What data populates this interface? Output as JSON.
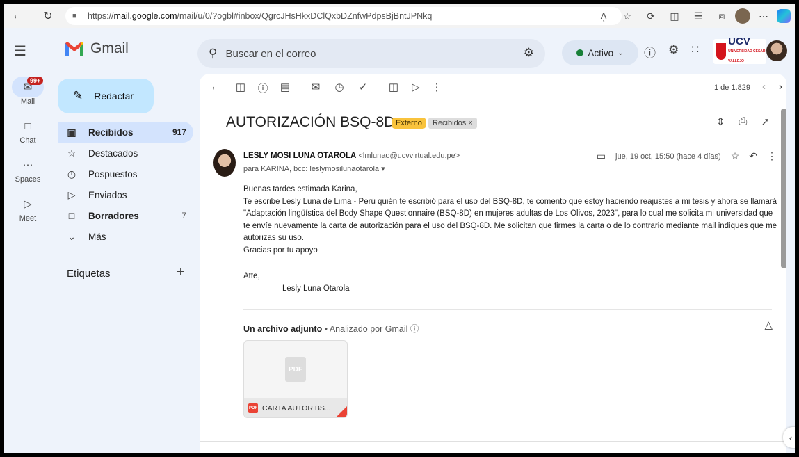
{
  "browser": {
    "url_prefix": "https://",
    "url_host": "mail.google.com",
    "url_path": "/mail/u/0/?ogbl#inbox/QgrcJHsHkxDClQxbDZnfwPdpsBjBntJPNkq",
    "reader_label": "Aͅ"
  },
  "header": {
    "brand": "Gmail",
    "search_placeholder": "Buscar en el correo",
    "status": "Activo",
    "org_logo": "UCV",
    "org_logo_sub": "UNIVERSIDAD CÉSAR VALLEJO"
  },
  "rail": {
    "items": [
      {
        "label": "Mail",
        "badge": "99+"
      },
      {
        "label": "Chat"
      },
      {
        "label": "Spaces"
      },
      {
        "label": "Meet"
      }
    ]
  },
  "compose_label": "Redactar",
  "nav": {
    "items": [
      {
        "label": "Recibidos",
        "count": "917"
      },
      {
        "label": "Destacados"
      },
      {
        "label": "Pospuestos"
      },
      {
        "label": "Enviados"
      },
      {
        "label": "Borradores",
        "count": "7"
      },
      {
        "label": "Más"
      }
    ],
    "labels_heading": "Etiquetas"
  },
  "toolbar": {
    "pager": "1 de 1.829"
  },
  "email": {
    "subject": "AUTORIZACIÓN BSQ-8D",
    "chip_external": "Externo",
    "chip_inbox": "Recibidos ×",
    "sender_name": "LESLY MOSI LUNA OTAROLA",
    "sender_email": "<lmlunao@ucvvirtual.edu.pe>",
    "recipients": "para KARINA, bcc: leslymosilunaotarola ▾",
    "date": "jue, 19 oct, 15:50 (hace 4 días)",
    "greeting": "Buenas tardes estimada Karina,",
    "paragraph": "Te escribe Lesly Luna de Lima - Perú quién te escribió para el uso del BSQ-8D, te comento que estoy haciendo reajustes a mi tesis y ahora se llamará \"Adaptación lingüística del Body Shape Questionnaire (BSQ-8D) en mujeres adultas de Los Olivos, 2023\", para lo cual me solicita mi universidad que te envíe nuevamente la carta de autorización para el uso del BSQ-8D. Me solicitan que firmes la carta o de lo contrario mediante mail indiques que me autorizas su uso.",
    "thanks": "Gracias por tu apoyo",
    "closing": "Atte,",
    "signature": "Lesly Luna Otarola"
  },
  "attachments": {
    "heading": "Un archivo adjunto",
    "scan_note": " • Analizado por Gmail ⓘ",
    "file_name": "CARTA AUTOR BS...",
    "preview_badge": "PDF",
    "type_badge": "PDF"
  },
  "colors": {
    "compose_bg": "#c2e7ff",
    "nav_active": "#d3e3fd",
    "chip_external": "#f9c33c",
    "status_green": "#188038",
    "badge_red": "#c5221f"
  }
}
